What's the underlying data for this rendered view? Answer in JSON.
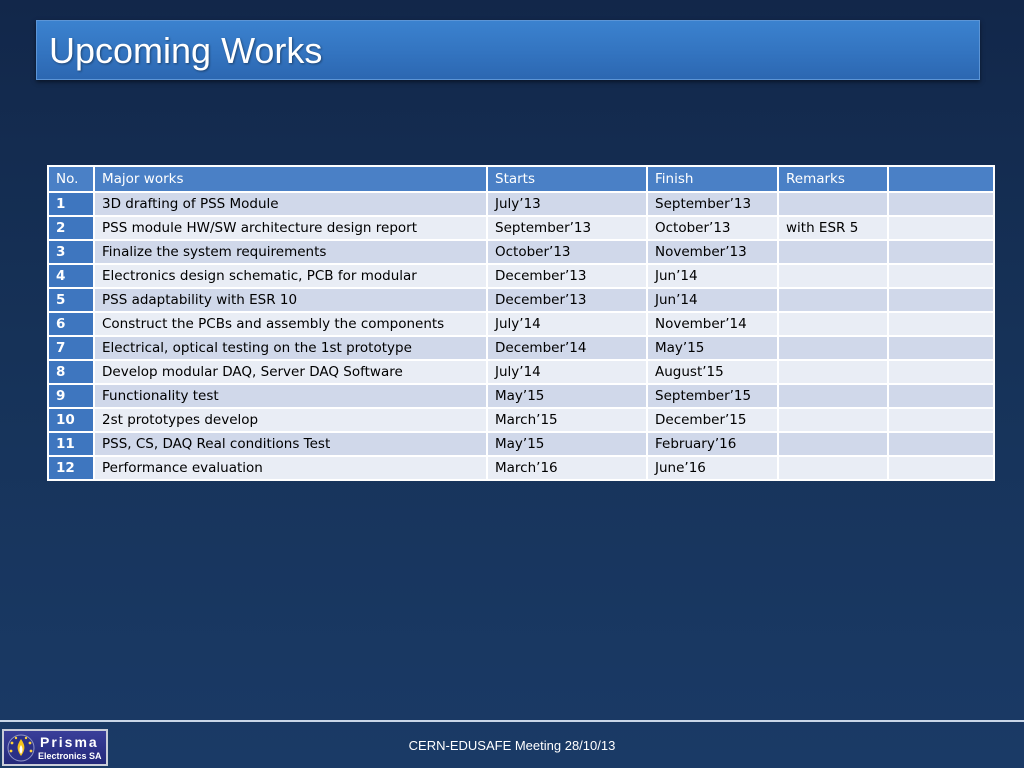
{
  "slide": {
    "title": "Upcoming Works",
    "footer": "CERN-EDUSAFE Meeting 28/10/13",
    "logo": {
      "name": "Prisma",
      "subtitle": "Electronics SA"
    }
  },
  "table": {
    "headers": [
      "No.",
      "Major works",
      "Starts",
      "Finish",
      "Remarks",
      ""
    ],
    "rows": [
      {
        "no": "1",
        "work": "3D drafting of PSS Module",
        "starts": "July’13",
        "finish": "September’13",
        "remarks": "",
        "extra": ""
      },
      {
        "no": "2",
        "work": "PSS module HW/SW architecture design report",
        "starts": "September’13",
        "finish": "October’13",
        "remarks": "with ESR 5",
        "extra": ""
      },
      {
        "no": "3",
        "work": "Finalize the system requirements",
        "starts": "October’13",
        "finish": "November’13",
        "remarks": "",
        "extra": ""
      },
      {
        "no": "4",
        "work": "Electronics design schematic, PCB for modular",
        "starts": "December’13",
        "finish": "Jun’14",
        "remarks": "",
        "extra": ""
      },
      {
        "no": "5",
        "work": "PSS adaptability with ESR 10",
        "starts": "December’13",
        "finish": "Jun’14",
        "remarks": "",
        "extra": ""
      },
      {
        "no": "6",
        "work": "Construct the PCBs and assembly the components",
        "starts": "July’14",
        "finish": "November’14",
        "remarks": "",
        "extra": ""
      },
      {
        "no": "7",
        "work": "Electrical, optical testing on the 1st prototype",
        "starts": "December’14",
        "finish": "May’15",
        "remarks": "",
        "extra": ""
      },
      {
        "no": "8",
        "work": "Develop modular DAQ, Server DAQ Software",
        "starts": "July’14",
        "finish": "August’15",
        "remarks": "",
        "extra": ""
      },
      {
        "no": "9",
        "work": "Functionality test",
        "starts": "May’15",
        "finish": "September’15",
        "remarks": "",
        "extra": ""
      },
      {
        "no": "10",
        "work": "2st prototypes develop",
        "starts": "March’15",
        "finish": "December’15",
        "remarks": "",
        "extra": ""
      },
      {
        "no": "11",
        "work": "PSS, CS, DAQ Real conditions Test",
        "starts": "May’15",
        "finish": "February’16",
        "remarks": "",
        "extra": ""
      },
      {
        "no": "12",
        "work": "Performance evaluation",
        "starts": "March’16",
        "finish": "June’16",
        "remarks": "",
        "extra": ""
      }
    ]
  }
}
